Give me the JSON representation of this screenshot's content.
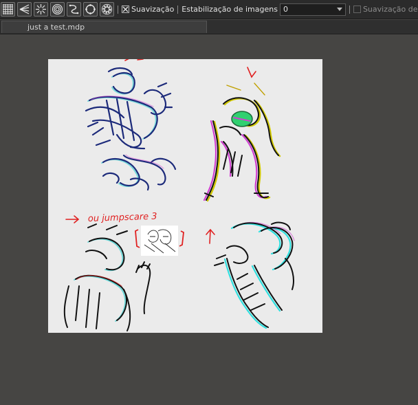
{
  "toolbar": {
    "tools": [
      {
        "icon": "grid-icon"
      },
      {
        "icon": "perspective-ruler-icon"
      },
      {
        "icon": "radial-lines-icon"
      },
      {
        "icon": "concentric-circles-icon"
      },
      {
        "icon": "curve-ruler-icon"
      },
      {
        "icon": "ellipse-ruler-icon"
      },
      {
        "icon": "settings-gear-icon"
      }
    ],
    "smoothing_label": "Suavização",
    "smoothing_checked": true,
    "stabilization_label": "Estabilização de imagens",
    "stabilization_value": "0",
    "brush_smoothing_label": "Suavização de Bo",
    "brush_smoothing_checked": false
  },
  "tabs": [
    {
      "label": "just a test.mdp"
    }
  ],
  "canvas": {
    "background": "#ebebeb",
    "annotation_text": "ou jumpscare 3",
    "stroke_colors": [
      "#1c2a7a",
      "#c0c000",
      "#d040d0",
      "#30e0e0",
      "#e02020",
      "#111111"
    ]
  },
  "colors": {
    "workspace": "#464543",
    "toolbar": "#2b2b2b",
    "accent_red": "#e02020"
  }
}
